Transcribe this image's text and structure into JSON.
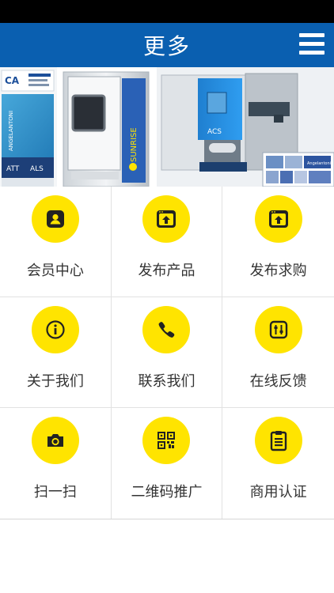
{
  "header": {
    "title": "更多",
    "menu_icon": "hamburger-menu-icon"
  },
  "banner": {
    "left_brand": "ANGELANTONI",
    "left_tags": [
      "ATT",
      "ALS"
    ],
    "center_brand": "SUNRISE",
    "right_brand": "ACS",
    "right_logo": "Angelantoni"
  },
  "grid": {
    "accent": "#ffe400",
    "items": [
      {
        "label": "会员中心",
        "icon": "member-card-icon"
      },
      {
        "label": "发布产品",
        "icon": "upload-window-icon"
      },
      {
        "label": "发布求购",
        "icon": "upload-window-icon"
      },
      {
        "label": "关于我们",
        "icon": "info-icon"
      },
      {
        "label": "联系我们",
        "icon": "phone-icon"
      },
      {
        "label": "在线反馈",
        "icon": "feedback-icon"
      },
      {
        "label": "扫一扫",
        "icon": "camera-icon"
      },
      {
        "label": "二维码推广",
        "icon": "qr-code-icon"
      },
      {
        "label": "商用认证",
        "icon": "clipboard-icon"
      }
    ]
  }
}
